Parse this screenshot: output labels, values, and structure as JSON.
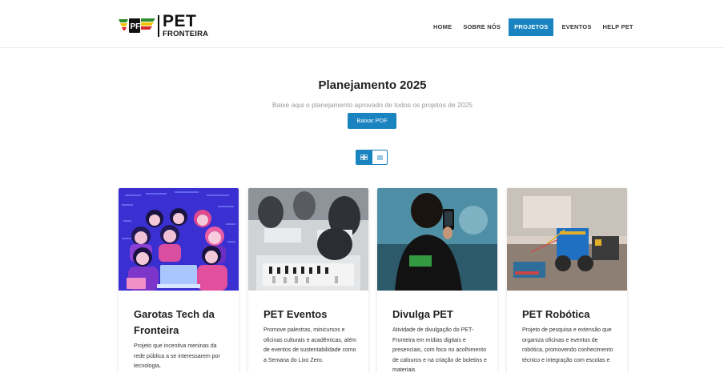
{
  "brand": {
    "logo_word": "PET",
    "logo_sub": "FRONTEIRA"
  },
  "nav": {
    "items": [
      {
        "label": "HOME",
        "active": false
      },
      {
        "label": "SOBRE NÓS",
        "active": false
      },
      {
        "label": "PROJETOS",
        "active": true
      },
      {
        "label": "EVENTOS",
        "active": false
      },
      {
        "label": "HELP PET",
        "active": false
      }
    ]
  },
  "hero": {
    "title": "Planejamento 2025",
    "subtitle": "Baixe aqui o planejamento aprovado de todos os projetos de 2025",
    "button_label": "Baixar PDF"
  },
  "view_toggle": {
    "grid_icon": "grid-icon",
    "list_icon": "list-icon",
    "selected": "grid"
  },
  "colors": {
    "accent": "#1a84c0"
  },
  "cards": [
    {
      "title": "Garotas Tech da Fronteira",
      "description": "Projeto que incentiva meninas da rede pública a se interessarem por tecnologia,"
    },
    {
      "title": "PET Eventos",
      "description": "Promove palestras, minicursos e oficinas culturais e acadêmicas, além de eventos de sustentabilidade como a Semana do Lixo Zero."
    },
    {
      "title": "Divulga PET",
      "description": "Atividade de divulgação do PET-Fronteira em mídias digitais e presenciais, com foco no acolhimento de calouros e na criação de boletins e materiais"
    },
    {
      "title": "PET Robótica",
      "description": "Projeto de pesquisa e extensão que organiza oficinas e eventos de robótica, promovendo conhecimento técnico e integração com escolas e"
    }
  ]
}
